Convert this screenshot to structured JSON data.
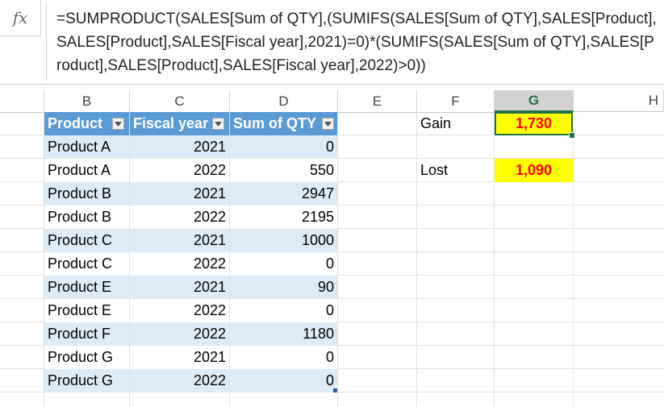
{
  "formula_bar": {
    "fx_label": "fx",
    "formula": "=SUMPRODUCT(SALES[Sum of QTY],(SUMIFS(SALES[Sum of QTY],SALES[Product],SALES[Product],SALES[Fiscal year],2021)=0)*(SUMIFS(SALES[Sum of QTY],SALES[Product],SALES[Product],SALES[Fiscal year],2022)>0))"
  },
  "columns": [
    "B",
    "C",
    "D",
    "E",
    "F",
    "G",
    "H"
  ],
  "selected_column": "G",
  "table": {
    "headers": [
      "Product",
      "Fiscal year",
      "Sum of QTY"
    ],
    "rows": [
      [
        "Product A",
        "2021",
        "0"
      ],
      [
        "Product A",
        "2022",
        "550"
      ],
      [
        "Product B",
        "2021",
        "2947"
      ],
      [
        "Product B",
        "2022",
        "2195"
      ],
      [
        "Product C",
        "2021",
        "1000"
      ],
      [
        "Product C",
        "2022",
        "0"
      ],
      [
        "Product E",
        "2021",
        "90"
      ],
      [
        "Product E",
        "2022",
        "0"
      ],
      [
        "Product F",
        "2022",
        "1180"
      ],
      [
        "Product G",
        "2021",
        "0"
      ],
      [
        "Product G",
        "2022",
        "0"
      ]
    ],
    "header_color": "#5b9bd5",
    "band_color": "#ddebf7"
  },
  "results": {
    "gain_label": "Gain",
    "gain_value": "1,730",
    "lost_label": "Lost",
    "lost_value": "1,090",
    "highlight_color": "#ffff00",
    "value_color": "#ff0000"
  },
  "accent_color": "#217346"
}
